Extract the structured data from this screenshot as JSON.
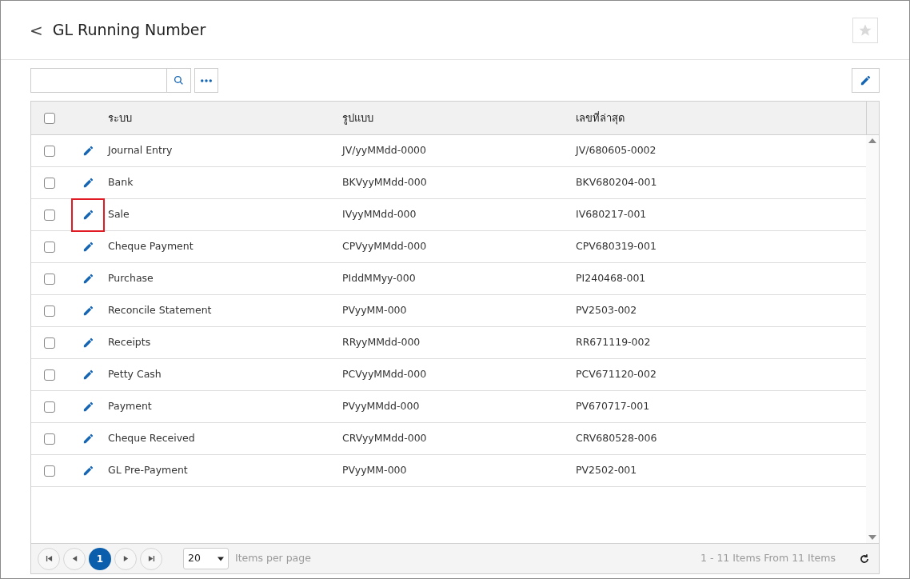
{
  "header": {
    "back": "<",
    "title": "GL Running Number",
    "favorite": false
  },
  "table": {
    "columns": [
      "ระบบ",
      "รูปแบบ",
      "เลขที่ล่าสุด"
    ],
    "select_all": false,
    "rows": [
      {
        "checked": false,
        "highlighted": false,
        "cells": [
          "Journal Entry",
          "JV/yyMMdd-0000",
          "JV/680605-0002"
        ]
      },
      {
        "checked": false,
        "highlighted": false,
        "cells": [
          "Bank",
          "BKVyyMMdd-000",
          "BKV680204-001"
        ]
      },
      {
        "checked": false,
        "highlighted": true,
        "cells": [
          "Sale",
          "IVyyMMdd-000",
          "IV680217-001"
        ]
      },
      {
        "checked": false,
        "highlighted": false,
        "cells": [
          "Cheque Payment",
          "CPVyyMMdd-000",
          "CPV680319-001"
        ]
      },
      {
        "checked": false,
        "highlighted": false,
        "cells": [
          "Purchase",
          "PIddMMyy-000",
          "PI240468-001"
        ]
      },
      {
        "checked": false,
        "highlighted": false,
        "cells": [
          "Reconcile Statement",
          "PVyyMM-000",
          "PV2503-002"
        ]
      },
      {
        "checked": false,
        "highlighted": false,
        "cells": [
          "Receipts",
          "RRyyMMdd-000",
          "RR671119-002"
        ]
      },
      {
        "checked": false,
        "highlighted": false,
        "cells": [
          "Petty Cash",
          "PCVyyMMdd-000",
          "PCV671120-002"
        ]
      },
      {
        "checked": false,
        "highlighted": false,
        "cells": [
          "Payment",
          "PVyyMMdd-000",
          "PV670717-001"
        ]
      },
      {
        "checked": false,
        "highlighted": false,
        "cells": [
          "Cheque Received",
          "CRVyyMMdd-000",
          "CRV680528-006"
        ]
      },
      {
        "checked": false,
        "highlighted": false,
        "cells": [
          "GL Pre-Payment",
          "PVyyMM-000",
          "PV2502-001"
        ]
      }
    ]
  },
  "pager": {
    "pages": [
      {
        "label": "1",
        "selected": true
      }
    ],
    "page_size": "20",
    "page_size_label": "Items per page",
    "summary": "1 - 11 Items From 11 Items"
  }
}
